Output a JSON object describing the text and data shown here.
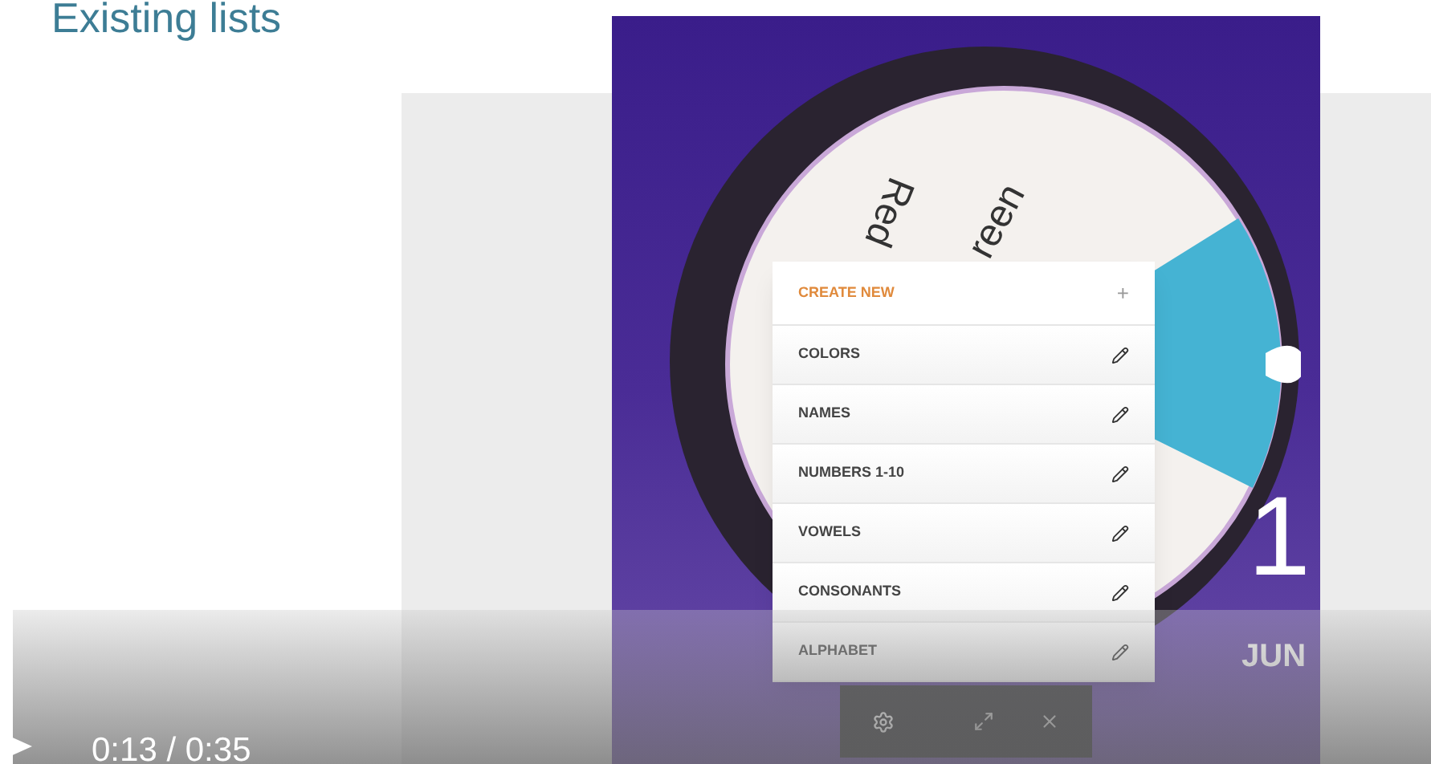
{
  "heading": "Existing lists",
  "app": {
    "wheel_labels": [
      "Red",
      "reen"
    ],
    "menu": {
      "create": {
        "label": "CREATE NEW",
        "symbol": "+"
      },
      "items": [
        {
          "label": "COLORS"
        },
        {
          "label": "NAMES"
        },
        {
          "label": "NUMBERS 1-10"
        },
        {
          "label": "VOWELS"
        },
        {
          "label": "CONSONANTS"
        },
        {
          "label": "ALPHABET"
        }
      ]
    },
    "date": {
      "day": "1",
      "month": "JUN"
    }
  },
  "player": {
    "time": "0:13 / 0:35"
  }
}
